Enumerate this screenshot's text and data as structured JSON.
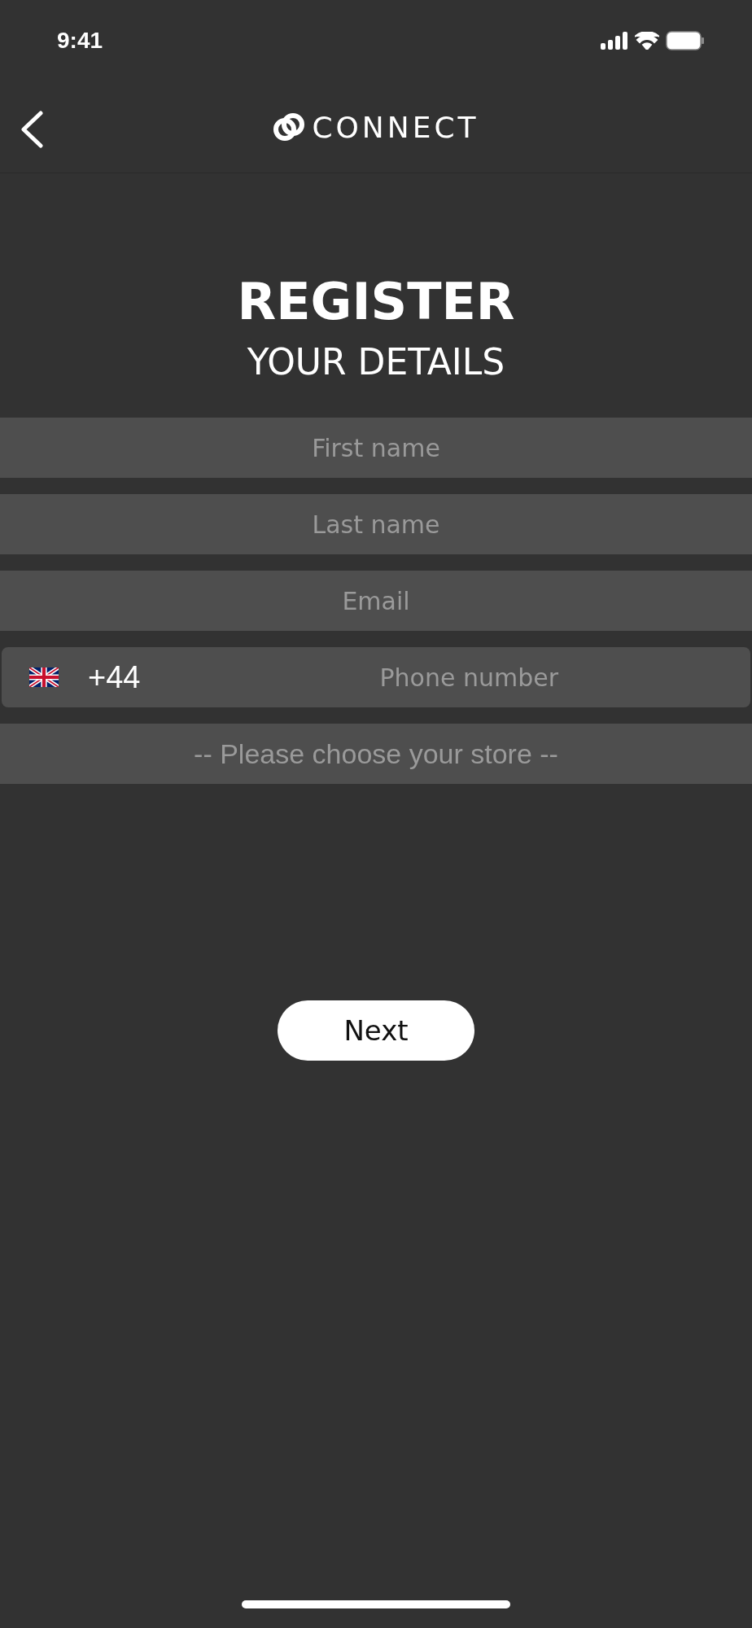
{
  "status_bar": {
    "time": "9:41"
  },
  "nav": {
    "brand": "CONNECT"
  },
  "heading": {
    "title": "REGISTER",
    "subtitle": "YOUR DETAILS"
  },
  "fields": [
    {
      "kind": "text",
      "placeholder": "First name"
    },
    {
      "kind": "text",
      "placeholder": "Last name"
    },
    {
      "kind": "text",
      "placeholder": "Email"
    },
    {
      "kind": "phone",
      "code": "+44",
      "placeholder": "Phone number"
    },
    {
      "kind": "select",
      "placeholder": "-- Please choose your store --"
    }
  ],
  "buttons": [
    "Next"
  ]
}
